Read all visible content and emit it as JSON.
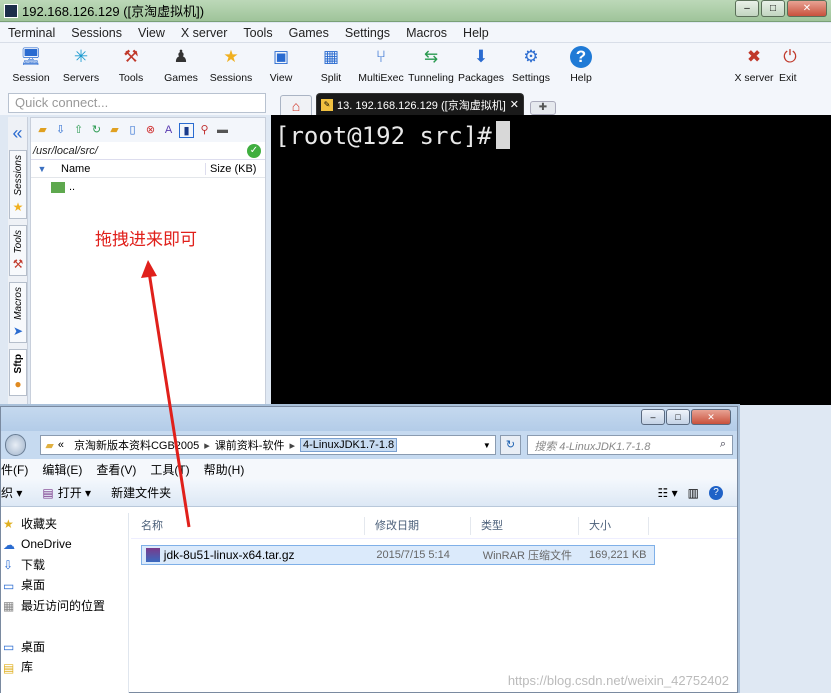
{
  "window": {
    "title": "192.168.126.129 ([京淘虚拟机])"
  },
  "menu": [
    "Terminal",
    "Sessions",
    "View",
    "X server",
    "Tools",
    "Games",
    "Settings",
    "Macros",
    "Help"
  ],
  "toolbar": [
    {
      "label": "Session",
      "icon": "session-icon",
      "glyph": "🖥"
    },
    {
      "label": "Servers",
      "icon": "servers-icon",
      "glyph": "✳"
    },
    {
      "label": "Tools",
      "icon": "tools-icon",
      "glyph": "⚒"
    },
    {
      "label": "Games",
      "icon": "games-icon",
      "glyph": "♟"
    },
    {
      "label": "Sessions",
      "icon": "star-icon",
      "glyph": "★"
    },
    {
      "label": "View",
      "icon": "view-icon",
      "glyph": "▣"
    },
    {
      "label": "Split",
      "icon": "split-icon",
      "glyph": "▦"
    },
    {
      "label": "MultiExec",
      "icon": "multiexec-icon",
      "glyph": "⑂"
    },
    {
      "label": "Tunneling",
      "icon": "tunneling-icon",
      "glyph": "⇆"
    },
    {
      "label": "Packages",
      "icon": "packages-icon",
      "glyph": "⬇"
    },
    {
      "label": "Settings",
      "icon": "settings-icon",
      "glyph": "⚙"
    },
    {
      "label": "Help",
      "icon": "help-icon",
      "glyph": "?"
    }
  ],
  "toolbar_right": [
    {
      "label": "X server",
      "icon": "xserver-icon",
      "glyph": "✖"
    },
    {
      "label": "Exit",
      "icon": "exit-icon",
      "glyph": "⏻"
    }
  ],
  "quick_connect": {
    "placeholder": "Quick connect..."
  },
  "tab": {
    "label": "13. 192.168.126.129 ([京淘虚拟机]"
  },
  "side_tabs": [
    "Sessions",
    "Tools",
    "Macros",
    "Sftp"
  ],
  "sftp": {
    "path": "/usr/local/src/",
    "columns": {
      "name": "Name",
      "size": "Size (KB)"
    },
    "rows": [
      {
        "name": ".."
      }
    ]
  },
  "annotation": "拖拽进来即可",
  "terminal": {
    "prompt": "[root@192 src]#"
  },
  "explorer": {
    "breadcrumb": [
      "京淘新版本资料CGB2005",
      "课前资料-软件",
      "4-LinuxJDK1.7-1.8"
    ],
    "breadcrumb_prefix": "«",
    "search_placeholder": "搜索 4-LinuxJDK1.7-1.8",
    "menu": [
      "件(F)",
      "编辑(E)",
      "查看(V)",
      "工具(T)",
      "帮助(H)"
    ],
    "commands": [
      "织 ▾",
      "打开 ▾",
      "新建文件夹"
    ],
    "nav": [
      "收藏夹",
      "OneDrive",
      "下载",
      "桌面",
      "最近访问的位置",
      "",
      "桌面",
      "库"
    ],
    "columns": {
      "name": "名称",
      "modified": "修改日期",
      "type": "类型",
      "size": "大小"
    },
    "file": {
      "name": "jdk-8u51-linux-x64.tar.gz",
      "modified": "2015/7/15 5:14",
      "type": "WinRAR 压缩文件",
      "size": "169,221 KB"
    }
  },
  "watermark": "https://blog.csdn.net/weixin_42752402",
  "colors": {
    "annotation": "#e0201b",
    "terminal_bg": "#000000",
    "accent": "#2a6bd0"
  }
}
